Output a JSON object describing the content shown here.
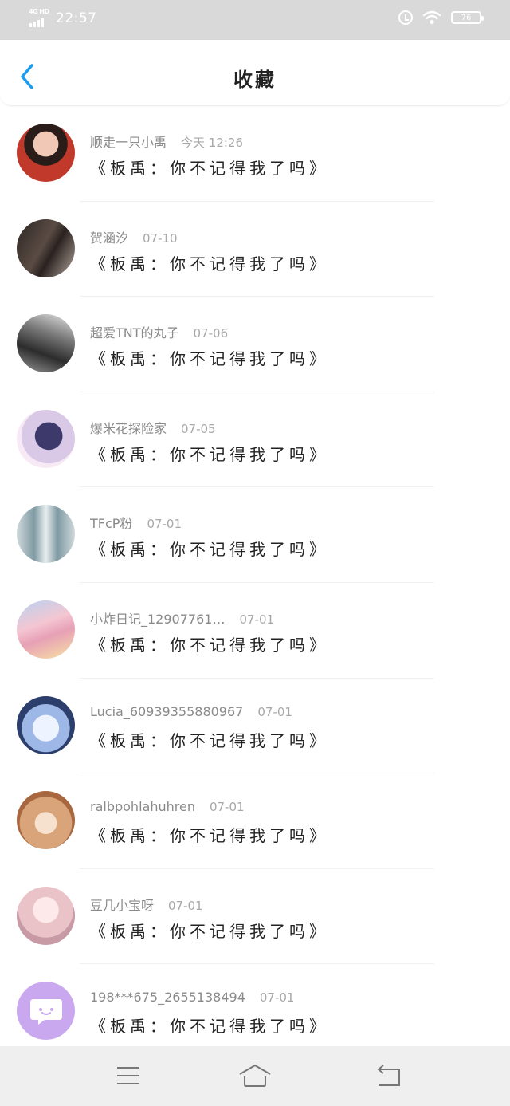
{
  "status_bar": {
    "network": "4G HD",
    "time": "22:57",
    "battery": "76",
    "icons": [
      "network-icon",
      "alarm-icon",
      "wifi-icon",
      "battery-icon"
    ]
  },
  "header": {
    "title": "收藏",
    "back_icon": "back-chevron-icon"
  },
  "favorites": [
    {
      "name": "顺走一只小禹",
      "date": "今天 12:26",
      "content": "《板禹：你不记得我了吗》",
      "avatar_color": "#c0392b"
    },
    {
      "name": "贺涵汐",
      "date": "07-10",
      "content": "《板禹：你不记得我了吗》",
      "avatar_color": "#3b3533"
    },
    {
      "name": "超爱TNT的丸子",
      "date": "07-06",
      "content": "《板禹：你不记得我了吗》",
      "avatar_color": "#5a5a5a"
    },
    {
      "name": "爆米花探险家",
      "date": "07-05",
      "content": "《板禹：你不记得我了吗》",
      "avatar_color": "#7a6f9a"
    },
    {
      "name": "TFcP粉",
      "date": "07-01",
      "content": "《板禹：你不记得我了吗》",
      "avatar_color": "#8fa9b3"
    },
    {
      "name": "小炸日记_12907761…",
      "date": "07-01",
      "content": "《板禹：你不记得我了吗》",
      "avatar_color": "#e7a0b6"
    },
    {
      "name": "Lucia_60939355880967",
      "date": "07-01",
      "content": "《板禹：你不记得我了吗》",
      "avatar_color": "#2c3e6b"
    },
    {
      "name": "ralbpohlahuhren",
      "date": "07-01",
      "content": "《板禹：你不记得我了吗》",
      "avatar_color": "#c98a5e"
    },
    {
      "name": "豆几小宝呀",
      "date": "07-01",
      "content": "《板禹：你不记得我了吗》",
      "avatar_color": "#e9c3c8"
    },
    {
      "name": "198***675_2655138494",
      "date": "07-01",
      "content": "《板禹：你不记得我了吗》",
      "avatar_color": "#c9a8f0"
    }
  ],
  "nav_bar": {
    "icons": [
      "menu-icon",
      "home-icon",
      "back-icon"
    ]
  },
  "colors": {
    "accent": "#1a9cf0",
    "status_bar_bg": "#d9d9d9",
    "nav_bar_bg": "#efefef"
  }
}
